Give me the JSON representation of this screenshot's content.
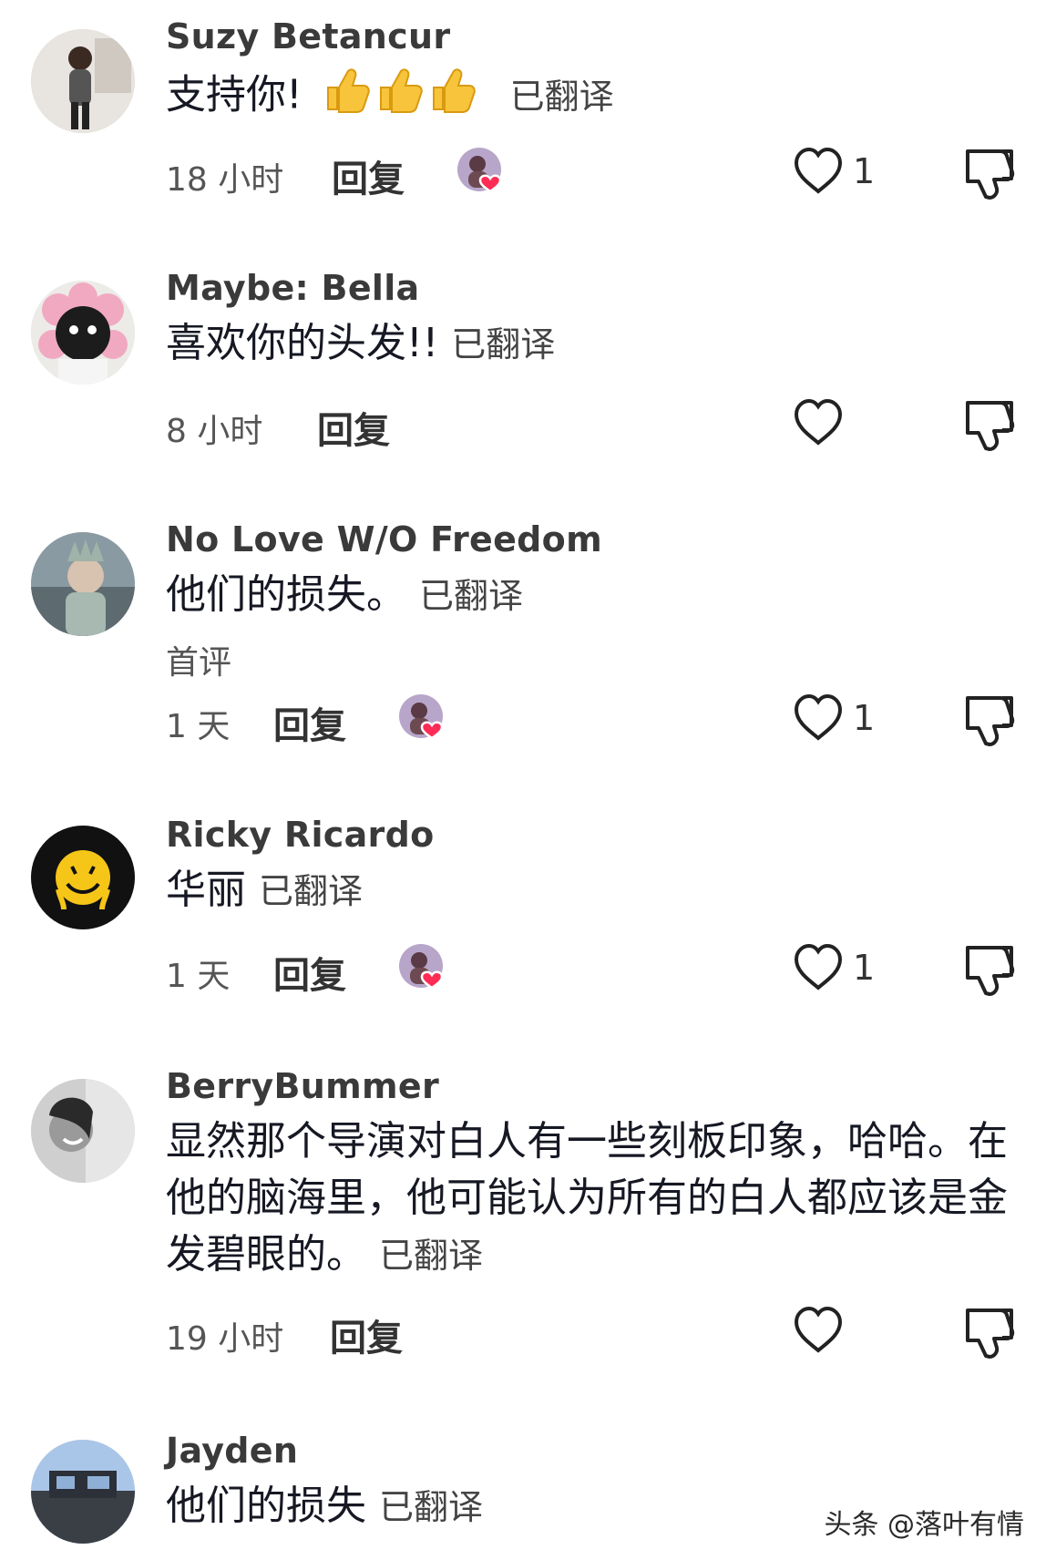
{
  "labels": {
    "translated": "已翻译",
    "reply": "回复"
  },
  "comments": [
    {
      "username": "Suzy Betancur",
      "text": "支持你!",
      "time": "18 小时",
      "likes": "1",
      "liked_by_creator": true,
      "first_tag": ""
    },
    {
      "username": "Maybe: Bella",
      "text": "喜欢你的头发!!",
      "time": "8 小时",
      "likes": "",
      "liked_by_creator": false,
      "first_tag": ""
    },
    {
      "username": "No Love W/O Freedom",
      "text": "他们的损失。",
      "time": "1 天",
      "likes": "1",
      "liked_by_creator": true,
      "first_tag": "首评"
    },
    {
      "username": "Ricky Ricardo",
      "text": "华丽",
      "time": "1 天",
      "likes": "1",
      "liked_by_creator": true,
      "first_tag": ""
    },
    {
      "username": "BerryBummer",
      "text": "显然那个导演对白人有一些刻板印象，哈哈。在他的脑海里，他可能认为所有的白人都应该是金发碧眼的。",
      "time": "19 小时",
      "likes": "",
      "liked_by_creator": false,
      "first_tag": ""
    },
    {
      "username": "Jayden",
      "text": "他们的损失",
      "time": "",
      "likes": "",
      "liked_by_creator": false,
      "first_tag": ""
    }
  ],
  "icons": {
    "like": "heart-outline-icon",
    "dislike": "thumbs-down-outline-icon",
    "liked_by_creator": "creator-avatar-heart-badge",
    "emoji": "thumbs-up-emoji"
  },
  "watermark": "头条 @落叶有情"
}
